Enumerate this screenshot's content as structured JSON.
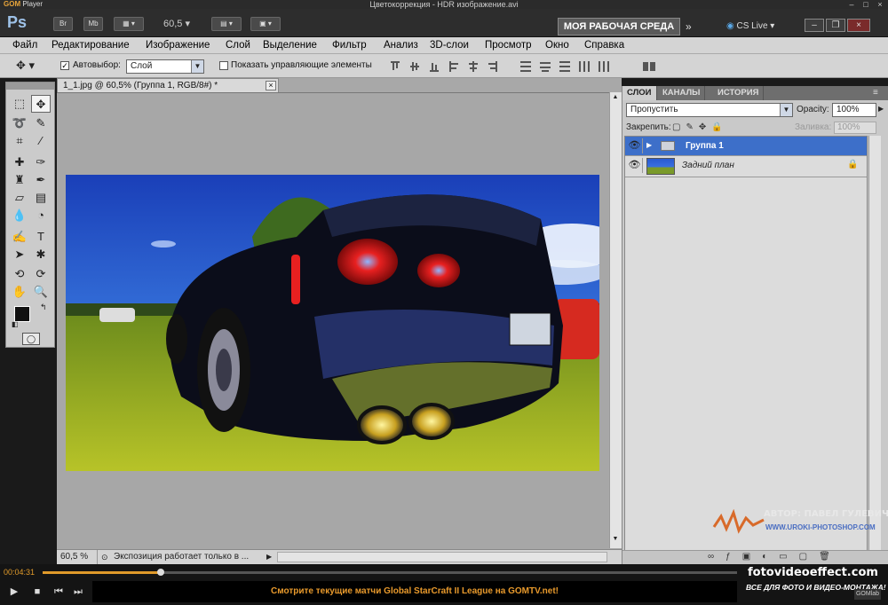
{
  "gom": {
    "logo": "GOM",
    "logo_sub": "Player",
    "window_title": "Цветокоррекция - HDR изображение.avi",
    "timecode": "00:04:31",
    "progress": 0.17,
    "site": "fotovideoeffect.com",
    "slogan": "ВСЕ ДЛЯ ФОТО И ВИДЕО-МОНТАЖА!",
    "ticker": "Смотрите текущие матчи Global StarCraft II League на GOMTV.net!",
    "gomlab": "GOMlab"
  },
  "ps": {
    "logo": "Ps",
    "appbar": {
      "br": "Br",
      "mb": "Mb",
      "zoom": "60,5",
      "workspace": "МОЯ РАБОЧАЯ СРЕДА",
      "cslive": "CS Live"
    },
    "menu": [
      "Файл",
      "Редактирование",
      "Изображение",
      "Слой",
      "Выделение",
      "Фильтр",
      "Анализ",
      "3D-слои",
      "Просмотр",
      "Окно",
      "Справка"
    ],
    "options": {
      "autoselect_label": "Автовыбор:",
      "autoselect_value": "Слой",
      "show_controls_label": "Показать управляющие элементы"
    },
    "document": {
      "tab_title": "1_1.jpg @ 60,5% (Группа 1, RGB/8#) *",
      "status_zoom": "60,5 %",
      "status_text": "Экспозиция работает только в ..."
    },
    "panels": {
      "tabs": [
        "СЛОИ",
        "КАНАЛЫ",
        "ИСТОРИЯ"
      ],
      "blend_mode": "Пропустить",
      "opacity_label": "Opacity:",
      "opacity_value": "100%",
      "lock_label": "Закрепить:",
      "fill_label": "Заливка:",
      "fill_value": "100%",
      "layers": [
        {
          "name": "Группа 1",
          "type": "group",
          "selected": true
        },
        {
          "name": "Задний план",
          "type": "background",
          "selected": false
        }
      ]
    }
  },
  "watermark": {
    "author": "АВТОР: ПАВЕЛ ГУЛЕВИЧ",
    "url": "WWW.UROKI-PHOTOSHOP.COM"
  },
  "colors": {
    "accent": "#e09a2a",
    "selection": "#3d6fc9",
    "ps_blue": "#9ec2e8"
  }
}
